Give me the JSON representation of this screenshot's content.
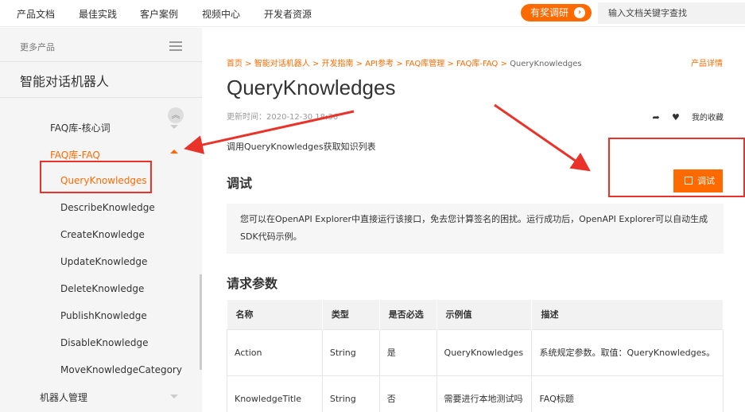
{
  "topnav": {
    "items": [
      "产品文档",
      "最佳实践",
      "客户案例",
      "视频中心",
      "开发者资源"
    ],
    "survey_label": "有奖调研",
    "survey_icon": "chevron-right-icon",
    "search_placeholder": "输入文档关键字查找",
    "accent_color": "#ff6a00"
  },
  "sidebar": {
    "more_products": "更多产品",
    "product_title": "智能对话机器人",
    "items": [
      {
        "label": "FAQ库-核心词"
      },
      {
        "label": "FAQ库-FAQ"
      },
      {
        "label": "QueryKnowledges"
      },
      {
        "label": "DescribeKnowledge"
      },
      {
        "label": "CreateKnowledge"
      },
      {
        "label": "UpdateKnowledge"
      },
      {
        "label": "DeleteKnowledge"
      },
      {
        "label": "PublishKnowledge"
      },
      {
        "label": "DisableKnowledge"
      },
      {
        "label": "MoveKnowledgeCategory"
      },
      {
        "label": "机器人管理"
      }
    ]
  },
  "main": {
    "breadcrumb": [
      "首页",
      "智能对话机器人",
      "开发指南",
      "API参考",
      "FAQ库管理",
      "FAQ库-FAQ",
      "QueryKnowledges"
    ],
    "detail_link": "产品详情",
    "title": "QueryKnowledges",
    "update_time": "更新时间：2020-12-30 18:36",
    "favorite_label": "我的收藏",
    "description": "调用QueryKnowledges获取知识列表",
    "debug_heading": "调试",
    "debug_button": "调试",
    "tip_text": "您可以在OpenAPI Explorer中直接运行该接口，免去您计算签名的困扰。运行成功后，OpenAPI Explorer可以自动生成SDK代码示例。",
    "params_heading": "请求参数",
    "table": {
      "headers": [
        "名称",
        "类型",
        "是否必选",
        "示例值",
        "描述"
      ],
      "rows": [
        [
          "Action",
          "String",
          "是",
          "QueryKnowledges",
          "系统规定参数。取值：QueryKnowledges。"
        ],
        [
          "KnowledgeTitle",
          "String",
          "否",
          "需要进行本地测试吗",
          "FAQ标题"
        ]
      ]
    }
  },
  "annotation_color": "#e8322a"
}
